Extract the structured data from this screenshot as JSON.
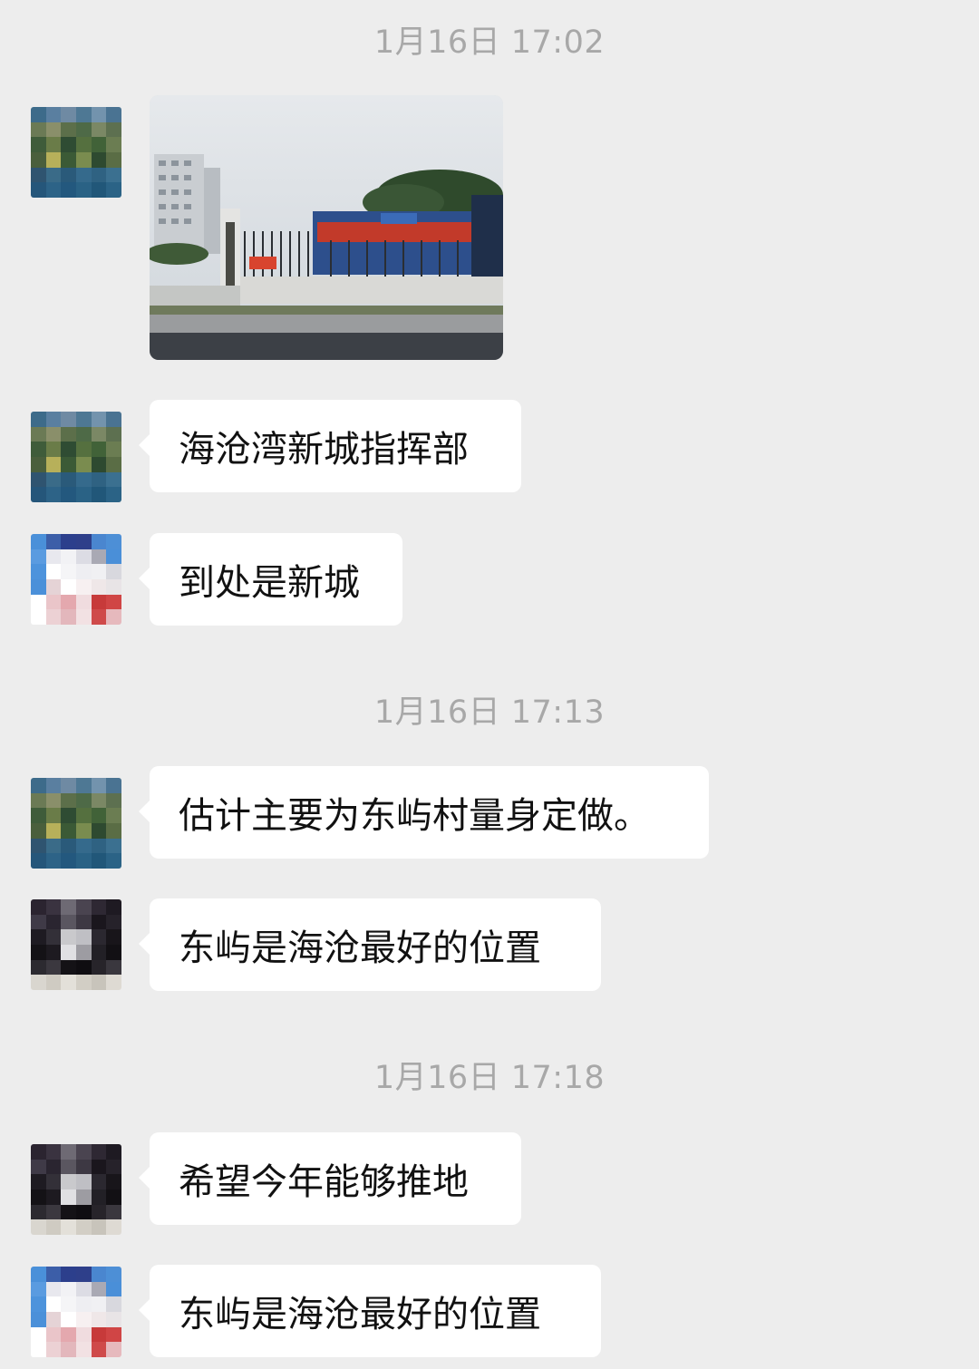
{
  "timestamps": [
    "1月16日 17:02",
    "1月16日 17:13",
    "1月16日 17:18"
  ],
  "messages": [
    {
      "type": "image",
      "avatar": "landscape-avatar"
    },
    {
      "type": "text",
      "avatar": "landscape-avatar",
      "text": "海沧湾新城指挥部"
    },
    {
      "type": "text",
      "avatar": "blue-pixel-avatar",
      "text": "到处是新城"
    },
    {
      "type": "text",
      "avatar": "landscape-avatar",
      "text": "估计主要为东屿村量身定做。"
    },
    {
      "type": "text",
      "avatar": "dark-pixel-avatar",
      "text": "东屿是海沧最好的位置"
    },
    {
      "type": "text",
      "avatar": "dark-pixel-avatar",
      "text": "希望今年能够推地"
    },
    {
      "type": "text",
      "avatar": "blue-pixel-avatar",
      "text": "东屿是海沧最好的位置"
    }
  ],
  "colors": {
    "background": "#ededed",
    "bubble": "#ffffff",
    "timestamp": "#a8a8a8"
  }
}
